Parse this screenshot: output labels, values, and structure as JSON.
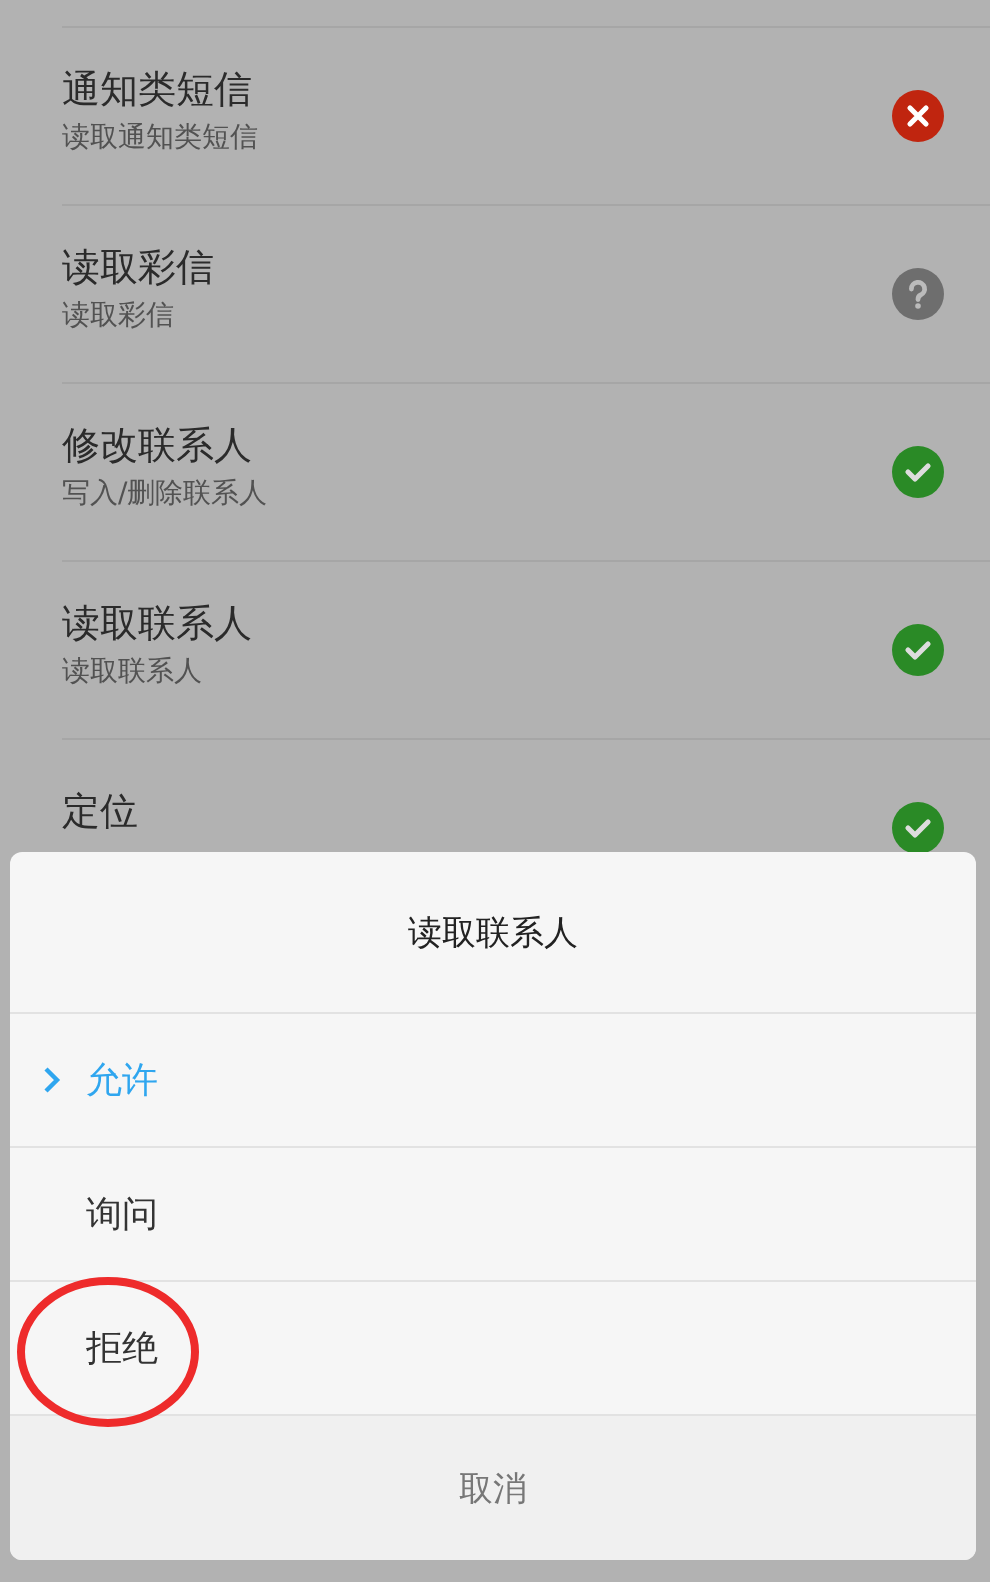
{
  "permissions": [
    {
      "title": "通知类短信",
      "description": "读取通知类短信",
      "kind": "denied"
    },
    {
      "title": "读取彩信",
      "description": "读取彩信",
      "kind": "ask"
    },
    {
      "title": "修改联系人",
      "description": "写入/删除联系人",
      "kind": "allowed"
    },
    {
      "title": "读取联系人",
      "description": "读取联系人",
      "kind": "allowed"
    },
    {
      "title": "定位",
      "kind": "allowed"
    }
  ],
  "dialog": {
    "title": "读取联系人",
    "options": [
      {
        "label": "允许",
        "selected": true,
        "circled": false
      },
      {
        "label": "询问",
        "selected": false,
        "circled": false
      },
      {
        "label": "拒绝",
        "selected": false,
        "circled": true
      }
    ],
    "cancel": "取消"
  }
}
